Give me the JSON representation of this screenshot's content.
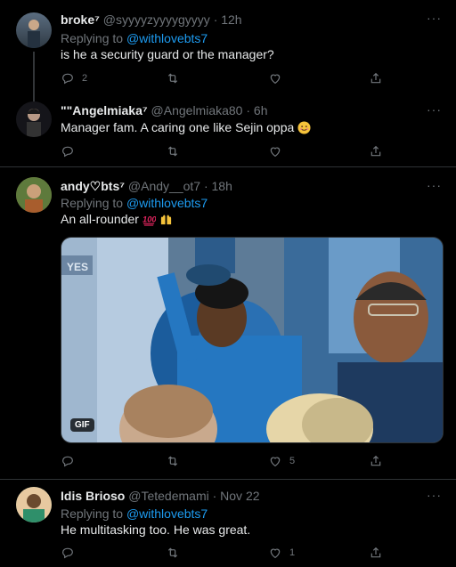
{
  "tweets": [
    {
      "name": "broke⁷",
      "handle": "@syyyyzyyyygyyyy",
      "time": "· 12h",
      "replying_label": "Replying to",
      "replying_to": "@withlovebts7",
      "text": "is he a security guard or the manager?",
      "replies": "2",
      "retweets": "",
      "likes": ""
    },
    {
      "name": "\"\"Angelmiaka⁷",
      "handle": "@Angelmiaka80",
      "time": "· 6h",
      "text": "Manager fam. A caring one like Sejin oppa",
      "replies": "",
      "retweets": "",
      "likes": ""
    },
    {
      "name": "andy♡bts⁷",
      "handle": "@Andy__ot7",
      "time": "· 18h",
      "replying_label": "Replying to",
      "replying_to": "@withlovebts7",
      "text": "An all-rounder",
      "gif_label": "GIF",
      "replies": "",
      "retweets": "",
      "likes": "5"
    },
    {
      "name": "Idis Brioso",
      "handle": "@Tetedemami",
      "time": "· Nov 22",
      "replying_label": "Replying to",
      "replying_to": "@withlovebts7",
      "text": "He multitasking too. He was great.",
      "replies": "",
      "retweets": "",
      "likes": "1"
    }
  ],
  "more_label": "···",
  "colors": {
    "background": "#000000",
    "text": "#e7e9ea",
    "muted": "#71767b",
    "link": "#1d9bf0",
    "divider": "#2f3336"
  },
  "icons": [
    "reply-icon",
    "retweet-icon",
    "like-icon",
    "share-icon",
    "more-icon",
    "smiling-face-emoji",
    "hundred-points-emoji",
    "raising-hands-emoji"
  ]
}
